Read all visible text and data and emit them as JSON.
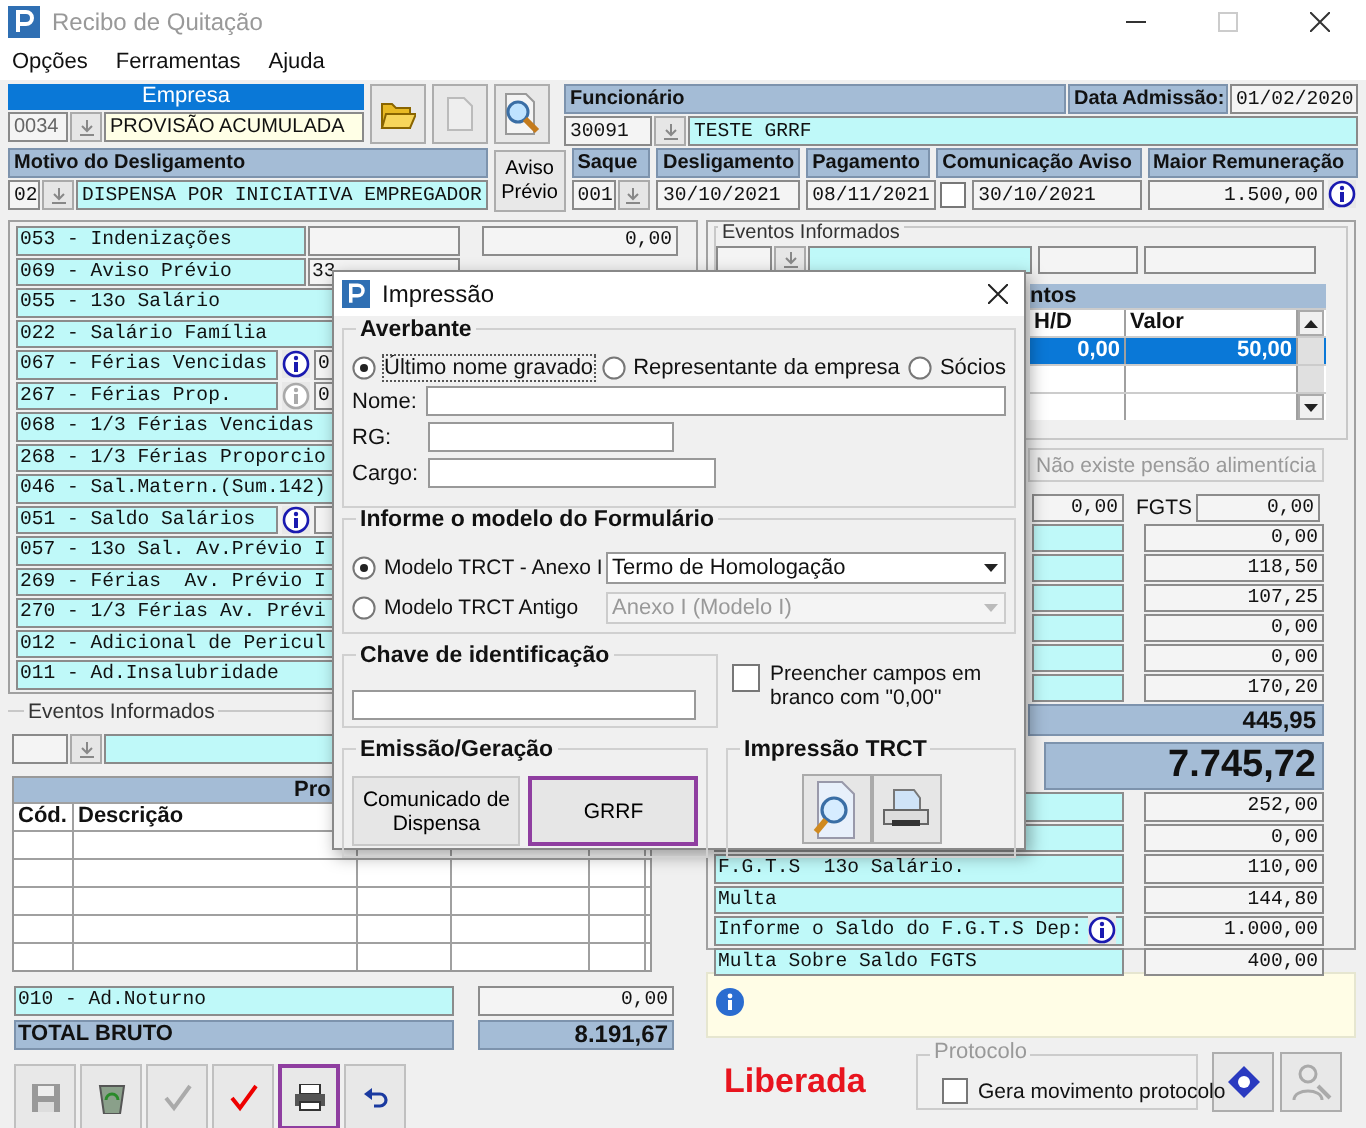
{
  "window": {
    "title": "Recibo de Quitação"
  },
  "menu": [
    {
      "label": "Opções"
    },
    {
      "label": "Ferramentas"
    },
    {
      "label": "Ajuda"
    }
  ],
  "header": {
    "empresa": {
      "label": "Empresa",
      "code": "0034",
      "name": "PROVISÃO ACUMULADA"
    },
    "funcionario": {
      "label": "Funcionário",
      "code": "30091",
      "name": "TESTE GRRF"
    },
    "admissao": {
      "label": "Data Admissão:",
      "value": "01/02/2020"
    },
    "motivo": {
      "label": "Motivo do Desligamento",
      "code": "02",
      "name": "DISPENSA POR INICIATIVA EMPREGADOR"
    },
    "aviso_previo_button": "Aviso Prévio",
    "saque": {
      "label": "Saque",
      "code": "001"
    },
    "desligamento": {
      "label": "Desligamento",
      "value": "30/10/2021"
    },
    "pagamento": {
      "label": "Pagamento",
      "value": "08/11/2021"
    },
    "comunicacao_aviso": {
      "label": "Comunicação Aviso",
      "checked": false,
      "value": "30/10/2021"
    },
    "maior_remuneracao": {
      "label": "Maior Remuneração",
      "value": "1.500,00"
    }
  },
  "proventos_rows": [
    {
      "text": "053 - Indenizações",
      "kind": "boxed",
      "value": "0,00"
    },
    {
      "text": "069 - Aviso Prévio",
      "kind": "boxed",
      "extra": "33"
    },
    {
      "text": "055 - 13o Salário",
      "kind": "wide"
    },
    {
      "text": "022 - Salário Família",
      "kind": "wide"
    },
    {
      "text": "067 - Férias Vencidas",
      "kind": "wide",
      "info": {
        "disabled": false
      },
      "extra": "0"
    },
    {
      "text": "267 - Férias Prop.",
      "kind": "wide",
      "info": {
        "disabled": true
      },
      "extra": "0"
    },
    {
      "text": "068 - 1/3 Férias Vencidas",
      "kind": "wide"
    },
    {
      "text": "268 - 1/3 Férias Proporcio",
      "kind": "wide"
    },
    {
      "text": "046 - Sal.Matern.(Sum.142)",
      "kind": "wide"
    },
    {
      "text": "051 - Saldo Salários",
      "kind": "wide",
      "info": {
        "disabled": false
      }
    },
    {
      "text": "057 - 13o Sal. Av.Prévio I",
      "kind": "wide"
    },
    {
      "text": "269 - Férias  Av. Prévio I",
      "kind": "wide"
    },
    {
      "text": "270 - 1/3 Férias Av. Prévi",
      "kind": "wide"
    },
    {
      "text": "012 - Adicional de Pericul",
      "kind": "wide"
    },
    {
      "text": "011 - Ad.Insalubridade",
      "kind": "wide"
    }
  ],
  "left_events": {
    "label": "Eventos Informados",
    "table_header": "Pro",
    "columns": [
      "Cód.",
      "Descrição"
    ]
  },
  "noturno": {
    "label": "010 - Ad.Noturno",
    "value": "0,00"
  },
  "total_bruto": {
    "label": "TOTAL BRUTO",
    "value": "8.191,67"
  },
  "toolbar": [
    {
      "kind": "save",
      "disabled": true,
      "selected": false
    },
    {
      "kind": "recycle",
      "disabled": false,
      "selected": false
    },
    {
      "kind": "check",
      "disabled": true,
      "selected": false
    },
    {
      "kind": "check",
      "disabled": false,
      "selected": false
    },
    {
      "kind": "print",
      "disabled": false,
      "selected": true
    },
    {
      "kind": "undo",
      "disabled": false,
      "selected": false
    }
  ],
  "right_events": {
    "label": "Eventos Informados",
    "table_header": "ntos",
    "columns": [
      "H/D",
      "Valor"
    ],
    "rows": [
      {
        "selected": true,
        "hd": "0,00",
        "valor": "50,00"
      },
      {
        "selected": false
      },
      {
        "selected": false
      }
    ]
  },
  "pensao": {
    "value": "Não existe pensão alimentícia",
    "disabled": true
  },
  "fgts_row": {
    "value_1": "0,00",
    "label": "FGTS",
    "value_2": "0,00"
  },
  "descontos_values": [
    "0,00",
    "118,50",
    "107,25",
    "0,00",
    "0,00",
    "170,20"
  ],
  "descontos_total": "445,95",
  "liquido": "7.745,72",
  "fgts_rows": [
    {
      "value": "252,00"
    },
    {
      "value": "0,00"
    },
    {
      "label": "F.G.T.S  13o Salário.",
      "value": "110,00"
    },
    {
      "label": "Multa",
      "value": "144,80"
    },
    {
      "label": "Informe o Saldo do F.G.T.S Dep:",
      "info": true,
      "value": "1.000,00"
    },
    {
      "label": "Multa Sobre Saldo FGTS",
      "value": "400,00"
    }
  ],
  "status": "Liberada",
  "protocolo": {
    "label": "Protocolo",
    "checkbox_label": "Gera movimento protocolo",
    "checked": false,
    "disabled": true
  },
  "dialog": {
    "title": "Impressão",
    "averbante": {
      "label": "Averbante",
      "options": [
        {
          "label": "Último nome gravado",
          "selected": true
        },
        {
          "label": "Representante da empresa",
          "selected": false
        },
        {
          "label": "Sócios",
          "selected": false
        }
      ],
      "fields": [
        {
          "label": "Nome:"
        },
        {
          "label": "RG:"
        },
        {
          "label": "Cargo:"
        }
      ]
    },
    "formulario": {
      "label": "Informe o modelo do Formulário",
      "options": [
        {
          "label": "Modelo TRCT - Anexo I",
          "selected": true,
          "select": "Termo de Homologação",
          "disabled": false
        },
        {
          "label": "Modelo TRCT Antigo",
          "selected": false,
          "select": "Anexo I (Modelo I)",
          "disabled": true
        }
      ]
    },
    "chave": {
      "label": "Chave de identificação"
    },
    "preencher": {
      "label": "Preencher campos em branco com \"0,00\"",
      "checked": false
    },
    "emissao": {
      "label": "Emissão/Geração",
      "buttons": [
        {
          "label": "Comunicado de Dispensa",
          "selected": false
        },
        {
          "label": "GRRF",
          "selected": true
        }
      ]
    },
    "impressao": {
      "label": "Impressão TRCT",
      "buttons": [
        {
          "kind": "preview"
        },
        {
          "kind": "print"
        }
      ]
    }
  }
}
